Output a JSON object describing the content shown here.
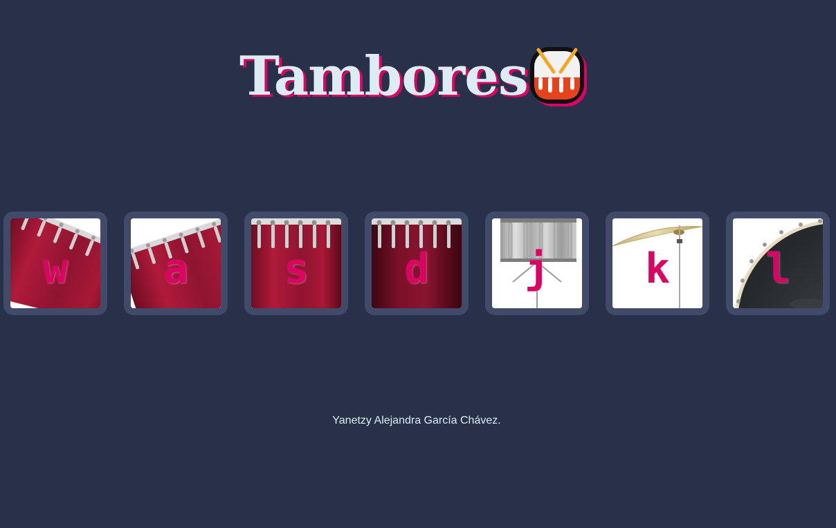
{
  "header": {
    "title": "Tambores",
    "emoji_icon": "drum-emoji-icon"
  },
  "keys": [
    {
      "letter": "w",
      "sound": "kick",
      "art": "red-drum-tilted-icon"
    },
    {
      "letter": "a",
      "sound": "tom",
      "art": "red-drum-tilted-icon"
    },
    {
      "letter": "s",
      "sound": "floor-tom",
      "art": "red-drum-front-icon"
    },
    {
      "letter": "d",
      "sound": "tom-dark",
      "art": "red-drum-front-icon"
    },
    {
      "letter": "j",
      "sound": "snare",
      "art": "silver-snare-icon"
    },
    {
      "letter": "k",
      "sound": "cymbal",
      "art": "cymbal-icon"
    },
    {
      "letter": "l",
      "sound": "bass-drum",
      "art": "bass-drum-icon"
    }
  ],
  "footer": {
    "author": "Yanetzy Alejandra García Chávez."
  },
  "colors": {
    "background": "#283149",
    "key_frame": "#404b69",
    "accent": "#da0463",
    "text_light": "#dbedf3"
  }
}
